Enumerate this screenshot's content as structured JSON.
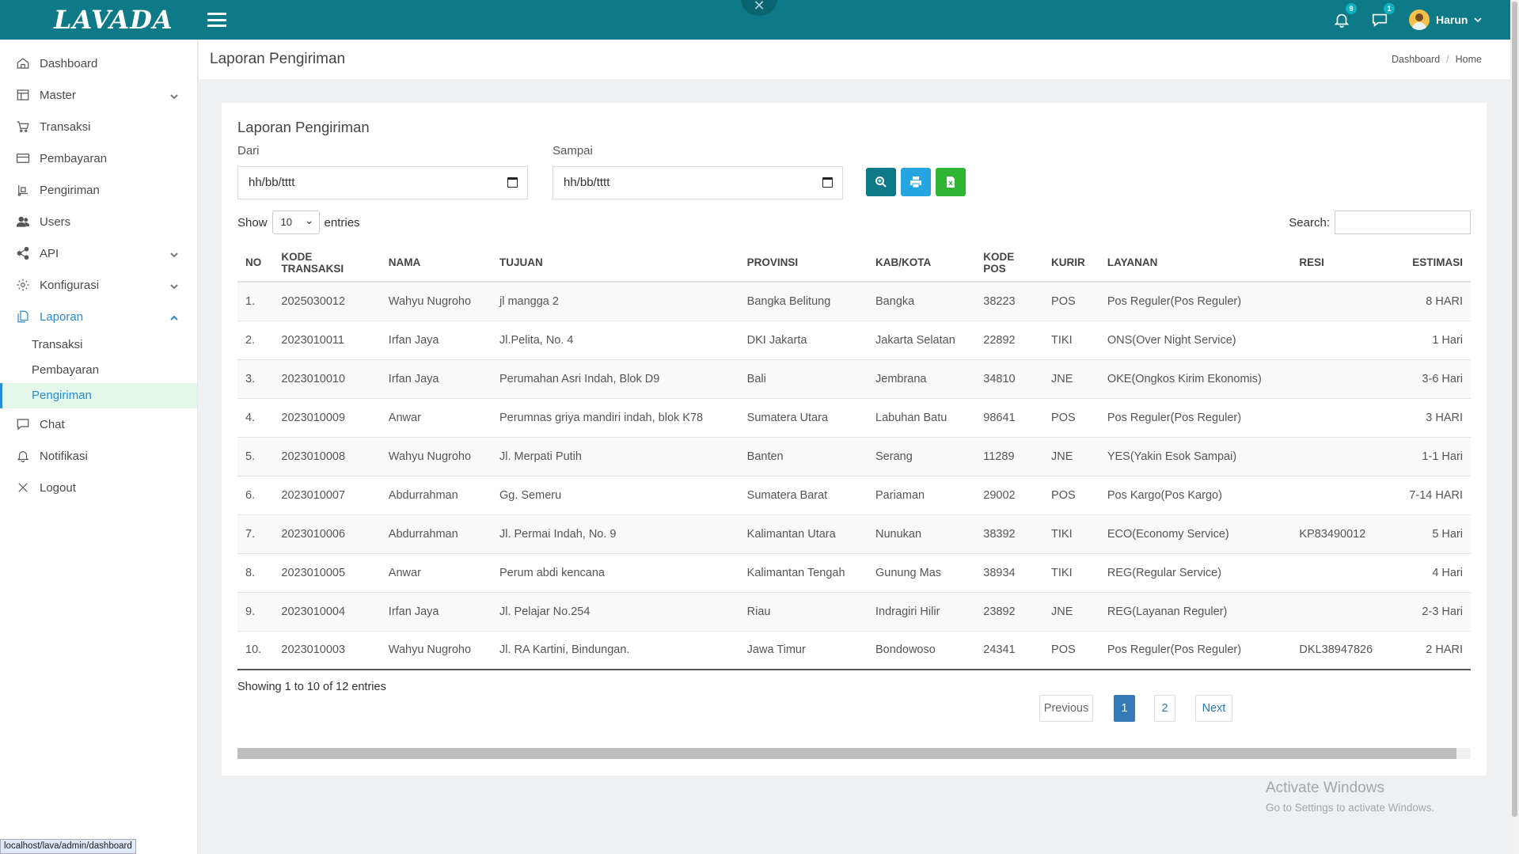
{
  "app": {
    "logo_text": "LAVADA",
    "brand_color": "#0e7a87"
  },
  "topbar": {
    "notifications_badge": "9",
    "messages_badge": "1",
    "user_name": "Harun"
  },
  "sidebar": {
    "items": [
      {
        "label": "Dashboard",
        "icon": "home-icon"
      },
      {
        "label": "Master",
        "icon": "layout-icon"
      },
      {
        "label": "Transaksi",
        "icon": "cart-icon"
      },
      {
        "label": "Pembayaran",
        "icon": "card-icon"
      },
      {
        "label": "Pengiriman",
        "icon": "truck-icon"
      },
      {
        "label": "Users",
        "icon": "users-icon"
      },
      {
        "label": "API",
        "icon": "share-icon"
      },
      {
        "label": "Konfigurasi",
        "icon": "gear-icon"
      },
      {
        "label": "Laporan",
        "icon": "files-icon"
      }
    ],
    "laporan_sub": [
      "Transaksi",
      "Pembayaran",
      "Pengiriman"
    ],
    "bottom_items": [
      {
        "label": "Chat",
        "icon": "chat-icon"
      },
      {
        "label": "Notifikasi",
        "icon": "bell-icon"
      },
      {
        "label": "Logout",
        "icon": "close-icon"
      }
    ]
  },
  "header": {
    "title": "Laporan Pengiriman",
    "breadcrumb": [
      "Dashboard",
      "Home"
    ]
  },
  "card": {
    "title": "Laporan Pengiriman",
    "from_label": "Dari",
    "to_label": "Sampai",
    "from_value": "hh/bb/tttt",
    "to_value": "hh/bb/tttt",
    "buttons": [
      {
        "name": "search-report-button",
        "color": "#0e7a87"
      },
      {
        "name": "print-button",
        "color": "#25a6e0"
      },
      {
        "name": "excel-export-button",
        "color": "#2fb533"
      }
    ]
  },
  "datatable": {
    "show_label": "Show",
    "entries_label": "entries",
    "page_size": "10",
    "search_label": "Search:",
    "columns": [
      "NO",
      "KODE TRANSAKSI",
      "NAMA",
      "TUJUAN",
      "PROVINSI",
      "KAB/KOTA",
      "KODE POS",
      "KURIR",
      "LAYANAN",
      "RESI",
      "ESTIMASI"
    ],
    "rows": [
      [
        "1.",
        "2025030012",
        "Wahyu Nugroho",
        "jl mangga 2",
        "Bangka Belitung",
        "Bangka",
        "38223",
        "POS",
        "Pos Reguler(Pos Reguler)",
        "",
        "8 HARI"
      ],
      [
        "2.",
        "2023010011",
        "Irfan Jaya",
        "Jl.Pelita, No. 4",
        "DKI Jakarta",
        "Jakarta Selatan",
        "22892",
        "TIKI",
        "ONS(Over Night Service)",
        "",
        "1 Hari"
      ],
      [
        "3.",
        "2023010010",
        "Irfan Jaya",
        "Perumahan Asri Indah, Blok D9",
        "Bali",
        "Jembrana",
        "34810",
        "JNE",
        "OKE(Ongkos Kirim Ekonomis)",
        "",
        "3-6 Hari"
      ],
      [
        "4.",
        "2023010009",
        "Anwar",
        "Perumnas griya mandiri indah, blok K78",
        "Sumatera Utara",
        "Labuhan Batu",
        "98641",
        "POS",
        "Pos Reguler(Pos Reguler)",
        "",
        "3 HARI"
      ],
      [
        "5.",
        "2023010008",
        "Wahyu Nugroho",
        "Jl. Merpati Putih",
        "Banten",
        "Serang",
        "11289",
        "JNE",
        "YES(Yakin Esok Sampai)",
        "",
        "1-1 Hari"
      ],
      [
        "6.",
        "2023010007",
        "Abdurrahman",
        "Gg. Semeru",
        "Sumatera Barat",
        "Pariaman",
        "29002",
        "POS",
        "Pos Kargo(Pos Kargo)",
        "",
        "7-14 HARI"
      ],
      [
        "7.",
        "2023010006",
        "Abdurrahman",
        "Jl. Permai Indah, No. 9",
        "Kalimantan Utara",
        "Nunukan",
        "38392",
        "TIKI",
        "ECO(Economy Service)",
        "KP83490012",
        "5 Hari"
      ],
      [
        "8.",
        "2023010005",
        "Anwar",
        "Perum abdi kencana",
        "Kalimantan Tengah",
        "Gunung Mas",
        "38934",
        "TIKI",
        "REG(Regular Service)",
        "",
        "4 Hari"
      ],
      [
        "9.",
        "2023010004",
        "Irfan Jaya",
        "Jl. Pelajar No.254",
        "Riau",
        "Indragiri Hilir",
        "23892",
        "JNE",
        "REG(Layanan Reguler)",
        "",
        "2-3 Hari"
      ],
      [
        "10.",
        "2023010003",
        "Wahyu Nugroho",
        "Jl. RA Kartini, Bindungan.",
        "Jawa Timur",
        "Bondowoso",
        "24341",
        "POS",
        "Pos Reguler(Pos Reguler)",
        "DKL38947826",
        "2 HARI"
      ]
    ],
    "info": "Showing 1 to 10 of 12 entries",
    "pagination": {
      "previous": "Previous",
      "pages": [
        "1",
        "2"
      ],
      "current": "1",
      "next": "Next"
    }
  },
  "watermark": {
    "line1": "Activate Windows",
    "line2": "Go to Settings to activate Windows."
  },
  "status_url": "localhost/lava/admin/dashboard"
}
